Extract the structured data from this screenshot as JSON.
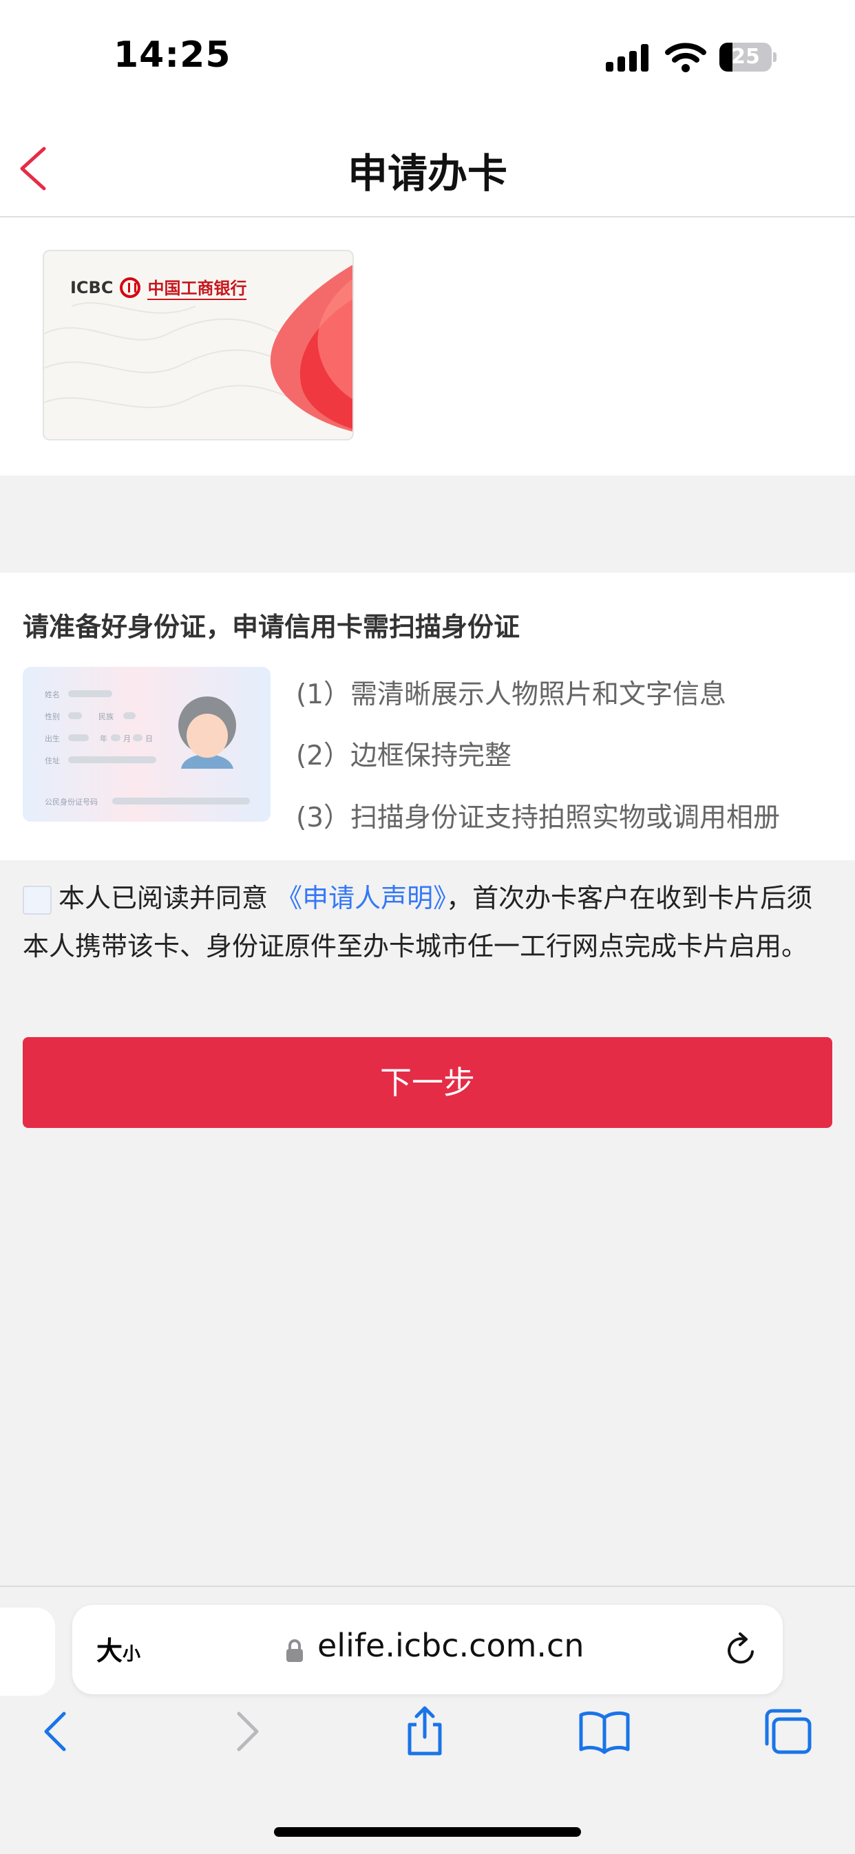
{
  "status_bar": {
    "time": "14:25",
    "battery": "25",
    "battery_level": 0.25
  },
  "nav": {
    "title": "申请办卡"
  },
  "card": {
    "brand_en": "ICBC",
    "brand_cn": "中国工商银行",
    "accent_color": "#e52c47"
  },
  "id_section": {
    "heading": "请准备好身份证，申请信用卡需扫描身份证",
    "tips": [
      "(1）需清晰展示人物照片和文字信息",
      "(2）边框保持完整",
      "(3）扫描身份证支持拍照实物或调用相册"
    ],
    "illustration_labels": [
      "姓名",
      "性别",
      "民族",
      "出生",
      "年",
      "月",
      "日",
      "住址",
      "公民身份证号码"
    ]
  },
  "agreement": {
    "prefix": "本人已阅读并同意",
    "link": "《申请人声明》",
    "suffix": "，首次办卡客户在收到卡片后须本人携带该卡、身份证原件至办卡城市任一工行网点完成卡片启用。",
    "checked": false
  },
  "next_button": {
    "label": "下一步"
  },
  "safari": {
    "text_size_big": "大",
    "text_size_small": "小",
    "url": "elife.icbc.com.cn"
  }
}
